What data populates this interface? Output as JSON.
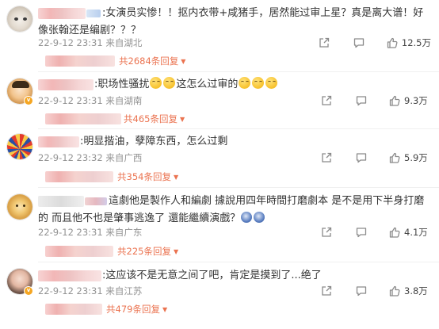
{
  "comments": [
    {
      "text": ":女演员实惨！！抠内衣带+咸猪手，居然能过审上星？真是离大谱！好像张翰还是编剧？？？",
      "meta": "22-9-12 23:31 来自湖北",
      "likes": "12.5万",
      "replies": "共2684条回复",
      "avatar_icon": "cat-avatar-icon"
    },
    {
      "text": ":职场性骚扰",
      "text_after": "这怎么过审的",
      "meta": "22-9-12 23:31 来自湖南",
      "likes": "9.3万",
      "replies": "共465条回复",
      "avatar_icon": "cartoon-avatar-icon"
    },
    {
      "text": ":明显揩油，孽障东西，怎么过剩",
      "meta": "22-9-12 23:32 来自广西",
      "likes": "5.9万",
      "replies": "共354条回复",
      "avatar_icon": "pattern-avatar-icon"
    },
    {
      "text": "這劇他是製作人和編劇 據說用四年時間打磨劇本 是不是用下半身打磨的 而且他不也是肇事逃逸了 還能繼續演戲？",
      "meta": "22-9-12 23:31 来自广东",
      "likes": "4.1万",
      "replies": "共225条回复",
      "avatar_icon": "lion-avatar-icon"
    },
    {
      "text": ":这应该不是无意之间了吧，肯定是摸到了...绝了",
      "meta": "22-9-12 23:31 来自江苏",
      "likes": "3.8万",
      "replies": "共479条回复",
      "avatar_icon": "person-avatar-icon"
    }
  ],
  "colors": {
    "accent": "#eb7350",
    "meta": "#939393",
    "text": "#333333"
  }
}
